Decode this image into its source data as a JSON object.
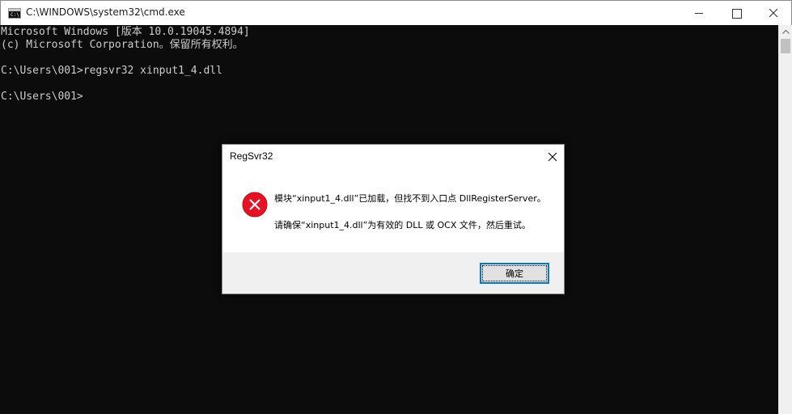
{
  "window": {
    "title": "C:\\WINDOWS\\system32\\cmd.exe",
    "icon_label": "C:\\"
  },
  "console": {
    "lines": [
      "Microsoft Windows [版本 10.0.19045.4894]",
      "(c) Microsoft Corporation。保留所有权利。",
      "",
      "C:\\Users\\001>regsvr32 xinput1_4.dll",
      "",
      "C:\\Users\\001>"
    ]
  },
  "dialog": {
    "title": "RegSvr32",
    "message_line1": "模块“xinput1_4.dll”已加载，但找不到入口点 DllRegisterServer。",
    "message_line2": "请确保“xinput1_4.dll”为有效的 DLL 或 OCX 文件，然后重试。",
    "ok_label": "确定",
    "icon": "error-icon",
    "error_color": "#e81123"
  }
}
